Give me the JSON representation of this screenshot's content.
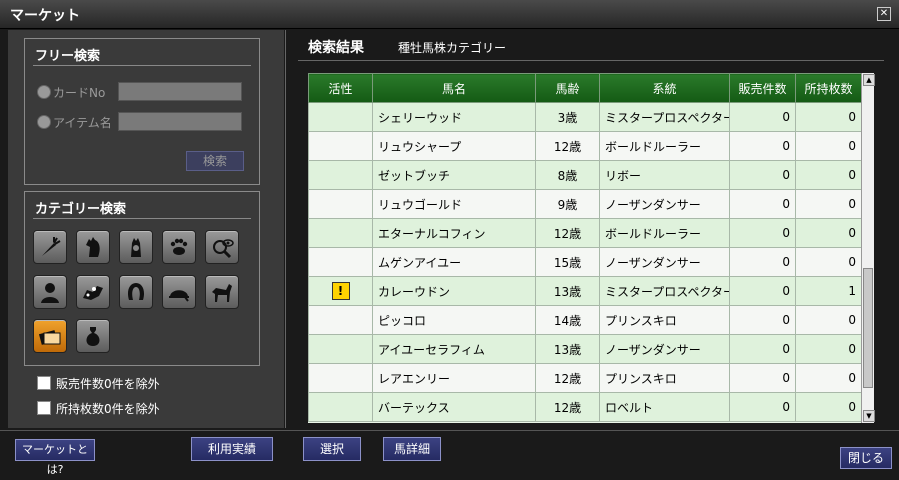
{
  "window": {
    "title": "マーケット"
  },
  "free_search": {
    "title": "フリー検索",
    "card_no_label": "カードNo",
    "item_name_label": "アイテム名",
    "search_button": "検索"
  },
  "category_search": {
    "title": "カテゴリー検索",
    "icons": [
      "carrot-icon",
      "horse-head-icon",
      "horse-hood-icon",
      "paw-icon",
      "magnifier-eye-icon",
      "person-icon",
      "jockey-icon",
      "horseshoe-icon",
      "helmet-icon",
      "horse-icon",
      "cards-icon",
      "bag-icon"
    ],
    "selected": "cards-icon"
  },
  "filters": {
    "exclude_zero_sales": "販売件数0件を除外",
    "exclude_zero_owned": "所持枚数0件を除外"
  },
  "results": {
    "title": "検索結果",
    "category": "種牡馬株カテゴリー",
    "columns": [
      "活性",
      "馬名",
      "馬齢",
      "系統",
      "販売件数",
      "所持枚数"
    ],
    "rows": [
      [
        "",
        "シェリーウッド",
        "3歳",
        "ミスタープロスペクター",
        "0",
        "0"
      ],
      [
        "",
        "リュウシャープ",
        "12歳",
        "ボールドルーラー",
        "0",
        "0"
      ],
      [
        "",
        "ゼットブッチ",
        "8歳",
        "リボー",
        "0",
        "0"
      ],
      [
        "",
        "リュウゴールド",
        "9歳",
        "ノーザンダンサー",
        "0",
        "0"
      ],
      [
        "",
        "エターナルコフィン",
        "12歳",
        "ボールドルーラー",
        "0",
        "0"
      ],
      [
        "",
        "ムゲンアイユー",
        "15歳",
        "ノーザンダンサー",
        "0",
        "0"
      ],
      [
        "!",
        "カレーウドン",
        "13歳",
        "ミスタープロスペクター",
        "0",
        "1"
      ],
      [
        "",
        "ピッコロ",
        "14歳",
        "プリンスキロ",
        "0",
        "0"
      ],
      [
        "",
        "アイユーセラフィム",
        "13歳",
        "ノーザンダンサー",
        "0",
        "0"
      ],
      [
        "",
        "レアエンリー",
        "12歳",
        "プリンスキロ",
        "0",
        "0"
      ],
      [
        "",
        "バーテックス",
        "12歳",
        "ロベルト",
        "0",
        "0"
      ]
    ]
  },
  "bottom": {
    "about_market": "マーケットとは?",
    "usage_history": "利用実績",
    "select": "選択",
    "horse_detail": "馬詳細",
    "close": "閉じる"
  }
}
